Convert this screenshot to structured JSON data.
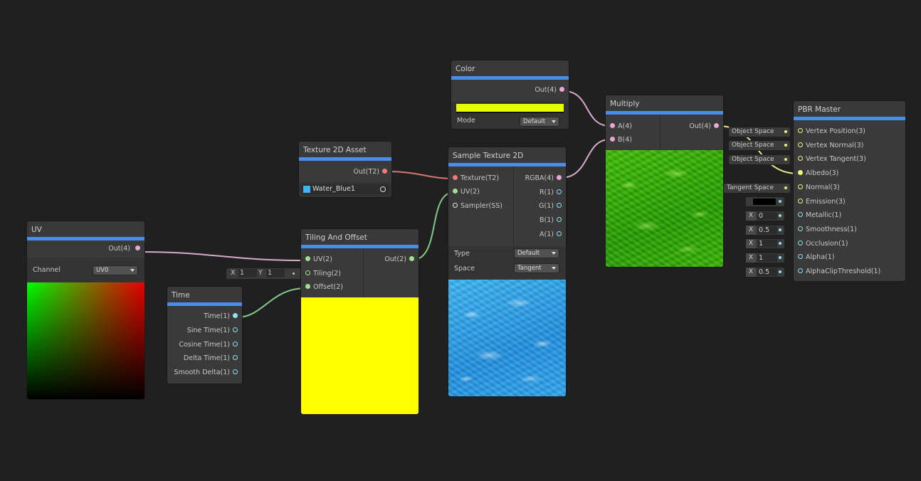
{
  "uv_node": {
    "title": "UV",
    "out": "Out(4)",
    "channel_label": "Channel",
    "channel_value": "UV0"
  },
  "time_node": {
    "title": "Time",
    "outputs": [
      "Time(1)",
      "Sine Time(1)",
      "Cosine Time(1)",
      "Delta Time(1)",
      "Smooth Delta(1)"
    ]
  },
  "tiling_node": {
    "title": "Tiling And Offset",
    "inputs": [
      "UV(2)",
      "Tiling(2)",
      "Offset(2)"
    ],
    "out": "Out(2)",
    "tiling_x_label": "X",
    "tiling_x": "1",
    "tiling_y_label": "Y",
    "tiling_y": "1",
    "preview_color": "#ffff00"
  },
  "tex_asset_node": {
    "title": "Texture 2D Asset",
    "out": "Out(T2)",
    "asset": "Water_Blue1"
  },
  "sample_node": {
    "title": "Sample Texture 2D",
    "inputs": [
      "Texture(T2)",
      "UV(2)",
      "Sampler(SS)"
    ],
    "outputs": [
      "RGBA(4)",
      "R(1)",
      "G(1)",
      "B(1)",
      "A(1)"
    ],
    "type_label": "Type",
    "type_value": "Default",
    "space_label": "Space",
    "space_value": "Tangent"
  },
  "color_node": {
    "title": "Color",
    "out": "Out(4)",
    "color": "#e5ff00",
    "mode_label": "Mode",
    "mode_value": "Default"
  },
  "multiply_node": {
    "title": "Multiply",
    "inputs": [
      "A(4)",
      "B(4)"
    ],
    "out": "Out(4)"
  },
  "pbr_node": {
    "title": "PBR Master",
    "inputs": [
      "Vertex Position(3)",
      "Vertex Normal(3)",
      "Vertex Tangent(3)",
      "Albedo(3)",
      "Normal(3)",
      "Emission(3)",
      "Metallic(1)",
      "Smoothness(1)",
      "Occlusion(1)",
      "Alpha(1)",
      "AlphaClipThreshold(1)"
    ]
  },
  "pbr_fields": {
    "vpos": "Object Space",
    "vnorm": "Object Space",
    "vtan": "Object Space",
    "normal": "Tangent Space",
    "x": "X",
    "metallic": "0",
    "smoothness": "0.5",
    "occlusion": "1",
    "alpha": "1",
    "clip": "0.5"
  },
  "colors": {
    "accent": "#4a8ded",
    "wire_pink": "#d8a9cc",
    "wire_green": "#82c98a",
    "wire_red": "#d7766e",
    "wire_yellow": "#e8e88a"
  }
}
